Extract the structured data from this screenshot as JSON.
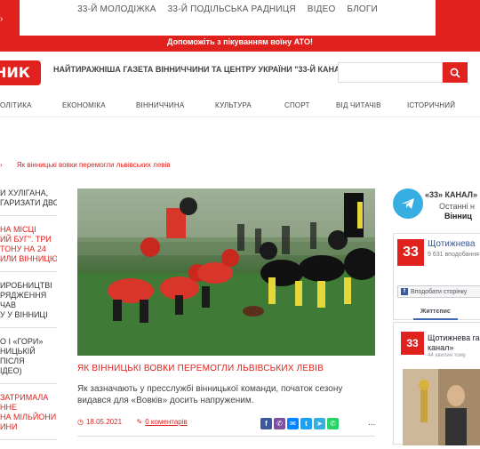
{
  "top_links": [
    "33-Й МОЛОДІЖКА",
    "33-Й ПОДІЛЬСЬКА РАДНИЦЯ",
    "ВІДЕО",
    "БЛОГИ"
  ],
  "help_text": "Допоможіть з пікуванням воїну АТО!",
  "tagline": "НАЙТИРАЖНІША ГАЗЕТА ВІННИЧЧИНИ ТА ЦЕНТРУ УКРАЇНИ \"33-Й КАНАЛ\"",
  "logo_fragment": "НИК",
  "search": {
    "placeholder": ""
  },
  "nav": [
    "ОЛІТИКА",
    "ЕКОНОМІКА",
    "ВІННИЧЧИНА",
    "КУЛЬТУРА",
    "СПОРТ",
    "ВІД ЧИТАЧІВ",
    "ІСТОРИЧНИЙ"
  ],
  "breadcrumb": {
    "arrow": "›",
    "current": "Як вінницькі вовки перемогли львівських левів"
  },
  "left_news": [
    {
      "lines": [
        "И ХУЛІГАНА,",
        "ГАРИЗАТИ ДВОХ"
      ],
      "color": "#333333"
    },
    {
      "lines": [
        "НА МІСЦІ",
        "ИЙ БУГ\". ТРИ",
        "ТОНУ НА 24",
        "ИЛИ ВІННИЦЮ"
      ],
      "color": "#e0211d"
    },
    {
      "lines": [
        "ИРОБНИЦТВІ",
        "РЯДЖЕННЯ",
        "ЧАВ",
        "У У ВІННИЦІ"
      ],
      "color": "#333333"
    },
    {
      "lines": [
        "О І «ГОРИ»",
        "НИЦЬКІЙ",
        "ПІСЛЯ",
        "ІДЕО)"
      ],
      "color": "#333333"
    },
    {
      "lines": [
        "ЗАТРИМАЛА",
        "ННЕ",
        "НА МІЛЬЙОНИ",
        "ИНИ"
      ],
      "color": "#e0211d"
    }
  ],
  "article": {
    "title": "ЯК ВІННИЦЬКІ ВОВКИ ПЕРЕМОГЛИ ЛЬВІВСЬКИХ ЛЕВІВ",
    "excerpt": "Як зазначають у пресслужбі вінницької команди, початок сезону видався для «Вовків» досить напруженим.",
    "date": "18.05.2021",
    "comments": "0 коментарів"
  },
  "share_icons": [
    {
      "name": "facebook-share-icon",
      "glyph": "f",
      "color": "#3b5998"
    },
    {
      "name": "viber-share-icon",
      "glyph": "✆",
      "color": "#7b519d"
    },
    {
      "name": "messenger-share-icon",
      "glyph": "✉",
      "color": "#0084ff"
    },
    {
      "name": "twitter-share-icon",
      "glyph": "t",
      "color": "#1da1f2"
    },
    {
      "name": "telegram-share-icon",
      "glyph": "➤",
      "color": "#37aee2"
    },
    {
      "name": "whatsapp-share-icon",
      "glyph": "✆",
      "color": "#25d366"
    }
  ],
  "more_dots": "...",
  "telegram": {
    "title": "«33» КАНАЛ»",
    "sub": "Останні н",
    "sub2": "Вінниц"
  },
  "fb_widget": {
    "name": "Щотижнева",
    "likes": "9 631 вподобання",
    "follow_btn": "Вподобати сторінку",
    "tab": "Життєпис",
    "logo_text": "33"
  },
  "fb_post": {
    "name_lines": [
      "Щотижнева га",
      "канал»"
    ],
    "time": "44 хвилин тому",
    "logo_text": "33"
  }
}
